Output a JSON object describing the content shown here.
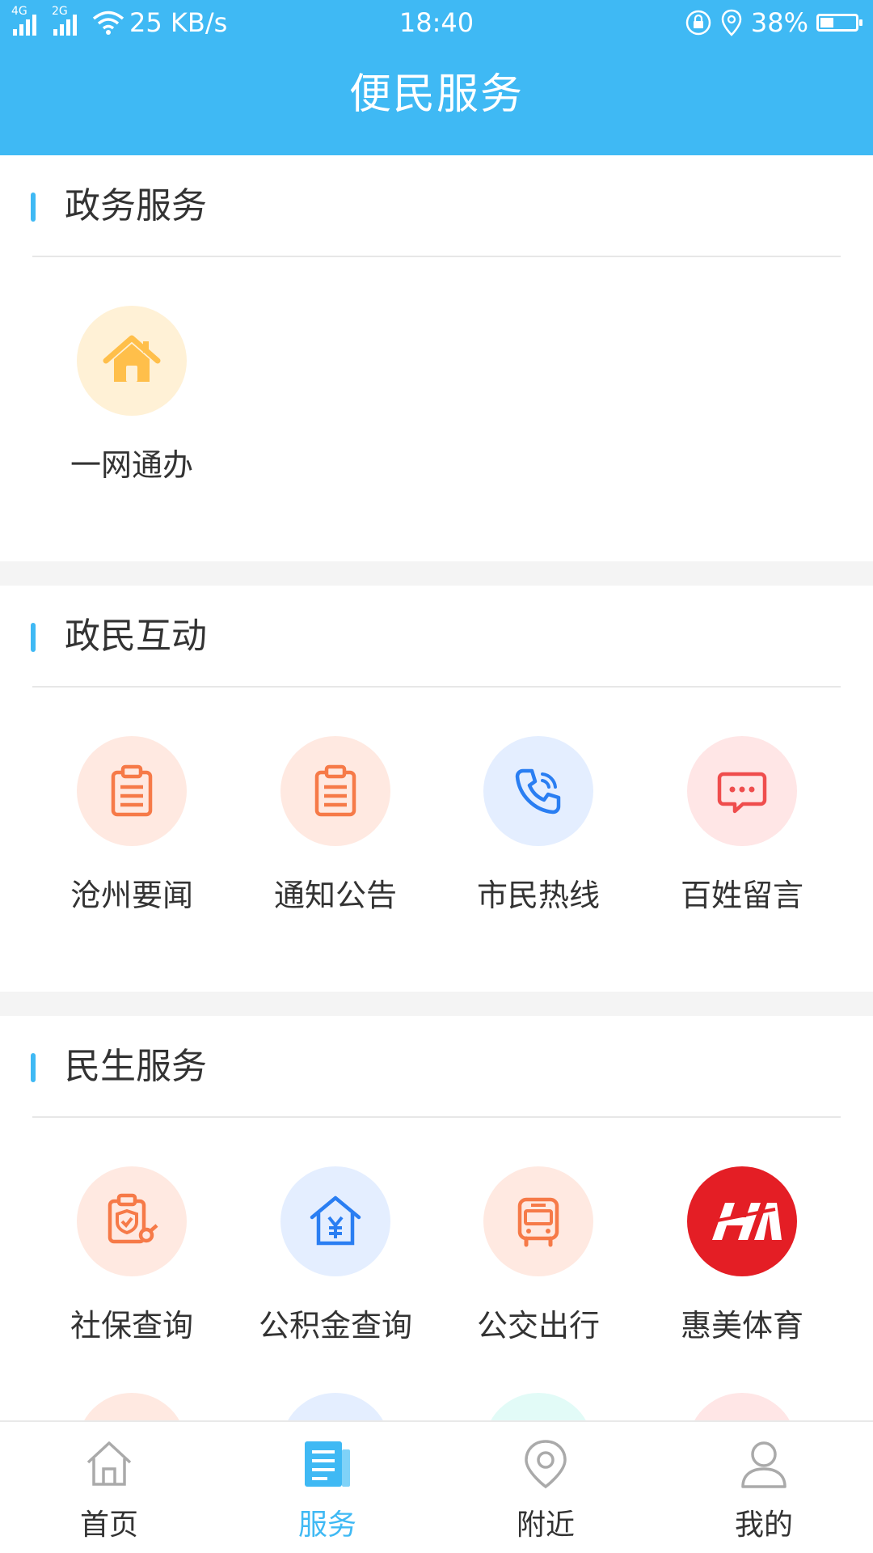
{
  "status_bar": {
    "signal1": "4G",
    "signal2": "2G",
    "speed": "25 KB/s",
    "time": "18:40",
    "battery": "38%",
    "battery_level": 0.38
  },
  "header": {
    "title": "便民服务"
  },
  "sections": [
    {
      "title": "政务服务",
      "items": [
        {
          "label": "一网通办",
          "icon": "house-icon",
          "bg": "#fff1d6",
          "color": "#ffbf4a"
        }
      ]
    },
    {
      "title": "政民互动",
      "items": [
        {
          "label": "沧州要闻",
          "icon": "clipboard-icon",
          "bg": "#ffe9e1",
          "color": "#f67a48"
        },
        {
          "label": "通知公告",
          "icon": "clipboard-icon",
          "bg": "#ffe9e1",
          "color": "#f67a48"
        },
        {
          "label": "市民热线",
          "icon": "phone-icon",
          "bg": "#e4eeff",
          "color": "#2a7ef2"
        },
        {
          "label": "百姓留言",
          "icon": "chat-bubble-icon",
          "bg": "#ffe6e6",
          "color": "#ef4d4d"
        }
      ]
    },
    {
      "title": "民生服务",
      "items": [
        {
          "label": "社保查询",
          "icon": "shield-doc-icon",
          "bg": "#ffe9e1",
          "color": "#f67a48"
        },
        {
          "label": "公积金查询",
          "icon": "house-yuan-icon",
          "bg": "#e4eeff",
          "color": "#2a7ef2"
        },
        {
          "label": "公交出行",
          "icon": "bus-icon",
          "bg": "#ffe9e1",
          "color": "#f67a48"
        },
        {
          "label": "惠美体育",
          "icon": "huimei-logo",
          "bg": "#e41e25",
          "color": "#ffffff"
        }
      ]
    }
  ],
  "bottom_nav": [
    {
      "label": "首页",
      "icon": "home-icon",
      "active": false
    },
    {
      "label": "服务",
      "icon": "news-doc-icon",
      "active": true
    },
    {
      "label": "附近",
      "icon": "location-pin-icon",
      "active": false
    },
    {
      "label": "我的",
      "icon": "user-icon",
      "active": false
    }
  ],
  "colors": {
    "primary": "#3fb9f4",
    "text": "#333333",
    "divider": "#e7e7e7"
  }
}
